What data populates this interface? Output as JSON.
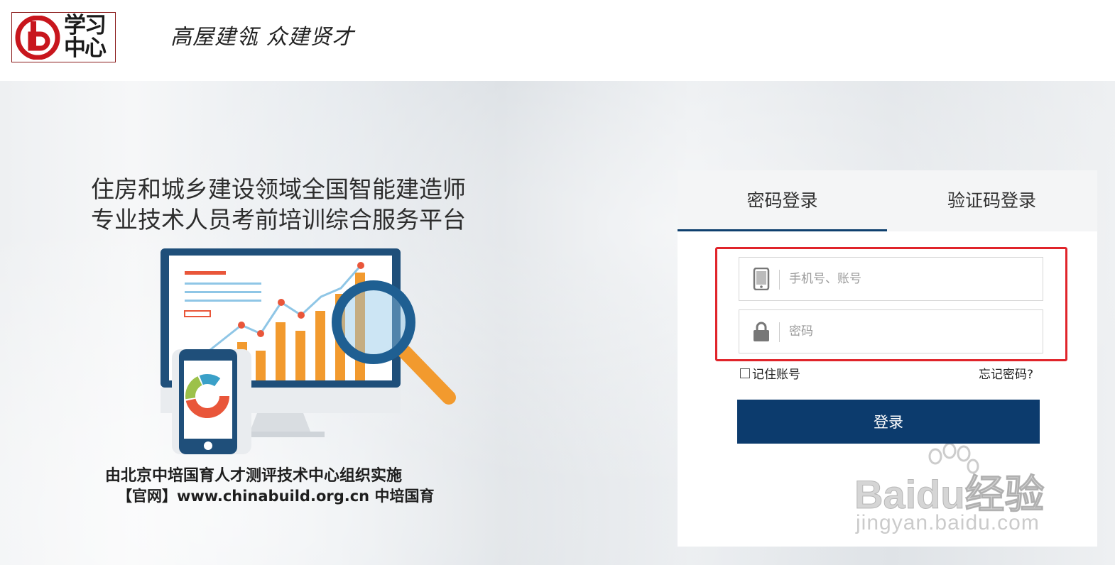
{
  "header": {
    "logo_text": "学习中心",
    "slogan": "高屋建瓴 众建贤才"
  },
  "hero": {
    "title_line1": "住房和城乡建设领域全国智能建造师",
    "title_line2": "专业技术人员考前培训综合服务平台",
    "footer_line1": "由北京中培国育人才测评技术中心组织实施",
    "footer_line2": "【官网】www.chinabuild.org.cn 中培国育"
  },
  "login": {
    "tabs": [
      {
        "label": "密码登录",
        "active": true
      },
      {
        "label": "验证码登录",
        "active": false
      }
    ],
    "username_placeholder": "手机号、账号",
    "password_placeholder": "密码",
    "remember_label": "记住账号",
    "forgot_label": "忘记密码?",
    "submit_label": "登录"
  },
  "watermark": {
    "brand": "Baidu经验",
    "url": "jingyan.baidu.com"
  },
  "colors": {
    "accent": "#0c3b6d",
    "highlight": "#e0242a",
    "logo_red": "#c8161d"
  },
  "icons": [
    "logo-mark-icon",
    "phone-icon",
    "lock-icon",
    "checkbox-icon",
    "paw-icon"
  ]
}
